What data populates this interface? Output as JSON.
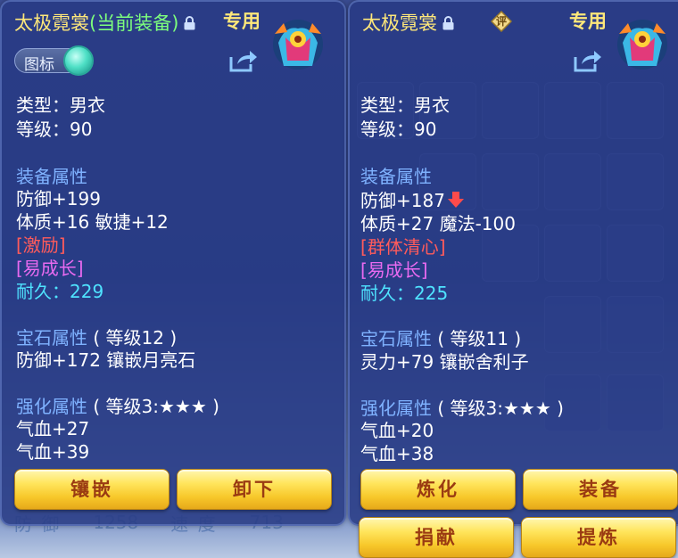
{
  "background": {
    "bottom_stats": [
      {
        "label": "防 御",
        "value": "1258"
      },
      {
        "label": "速 度",
        "value": "713"
      }
    ]
  },
  "left": {
    "name": "太极霓裳",
    "equipped_tag": "(当前装备)",
    "exclusive_tag": "专用",
    "icon_toggle_label": "图标",
    "type_line": "类型：男衣",
    "level_line": "等级：90",
    "equip_section": "装备属性",
    "attr1": "防御+199",
    "attr2": "体质+16 敏捷+12",
    "special_skill": "[激励]",
    "special_effect": "[易成长]",
    "durability": "耐久：229",
    "gem_section_title": "宝石属性",
    "gem_section_level": "( 等级12 )",
    "gem_line": "防御+172 镶嵌月亮石",
    "enhance_section_title": "强化属性",
    "enhance_section_level": "( 等级3:★★★ )",
    "enhance1": "气血+27",
    "enhance2": "气血+39",
    "buttons": [
      "镶嵌",
      "卸下"
    ]
  },
  "right": {
    "name": "太极霓裳",
    "rating_badge": "评",
    "exclusive_tag": "专用",
    "type_line": "类型：男衣",
    "level_line": "等级：90",
    "equip_section": "装备属性",
    "attr1": "防御+187",
    "attr2": "体质+27 魔法-100",
    "special_skill": "[群体清心]",
    "special_effect": "[易成长]",
    "durability": "耐久：225",
    "gem_section_title": "宝石属性",
    "gem_section_level": "( 等级11 )",
    "gem_line": "灵力+79 镶嵌舍利子",
    "enhance_section_title": "强化属性",
    "enhance_section_level": "( 等级3:★★★ )",
    "enhance1": "气血+20",
    "enhance2": "气血+38",
    "buttons": [
      "炼化",
      "装备",
      "捐献",
      "提炼"
    ]
  },
  "colors": {
    "title": "#ffe87a",
    "equipped": "#7dff7d",
    "section": "#7fb2ff",
    "skill": "#ff5b5b",
    "effect": "#e86af0",
    "durability": "#4fe3ff",
    "down_arrow": "#ff4b4b",
    "button_text": "#9a3b12"
  },
  "icons": [
    "lock-icon",
    "share-icon",
    "robe-item-icon",
    "rating-badge-icon",
    "down-arrow-icon"
  ]
}
